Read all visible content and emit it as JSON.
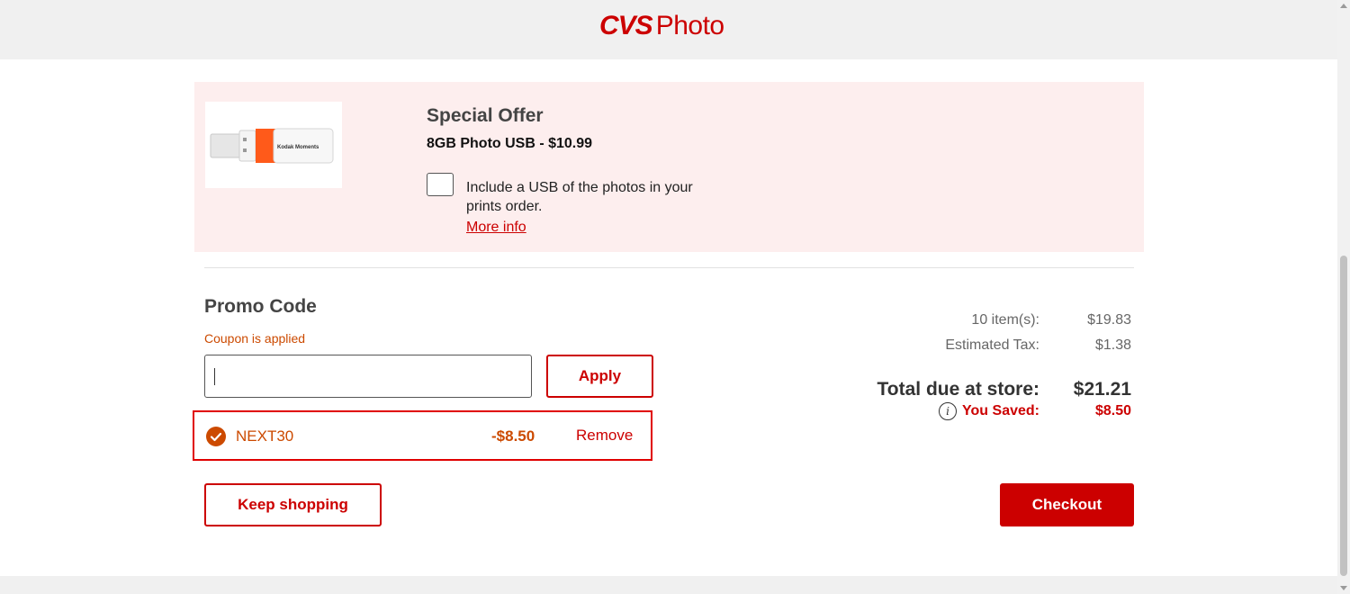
{
  "header": {
    "logo_cvs": "CVS",
    "logo_photo": "Photo"
  },
  "special_offer": {
    "title": "Special Offer",
    "product": "8GB Photo USB - $10.99",
    "checkbox_label": "Include a USB of the photos in your prints order.",
    "checkbox_checked": false,
    "more_info": "More info",
    "image_brand_text": "Kodak Moments"
  },
  "promo": {
    "title": "Promo Code",
    "status": "Coupon is applied",
    "input_value": "",
    "apply_label": "Apply",
    "applied_coupon": {
      "code": "NEXT30",
      "amount": "-$8.50",
      "remove_label": "Remove"
    }
  },
  "summary": {
    "items_label": "10 item(s):",
    "items_value": "$19.83",
    "tax_label": "Estimated Tax:",
    "tax_value": "$1.38",
    "total_label": "Total due at store:",
    "total_value": "$21.21",
    "saved_label": "You Saved:",
    "saved_value": "$8.50"
  },
  "actions": {
    "keep_shopping": "Keep shopping",
    "checkout": "Checkout"
  },
  "colors": {
    "brand_red": "#cc0000",
    "coupon_orange": "#cc4a00",
    "offer_bg": "#fdeeee"
  },
  "icons": [
    "checkmark-circle-icon",
    "info-icon"
  ]
}
